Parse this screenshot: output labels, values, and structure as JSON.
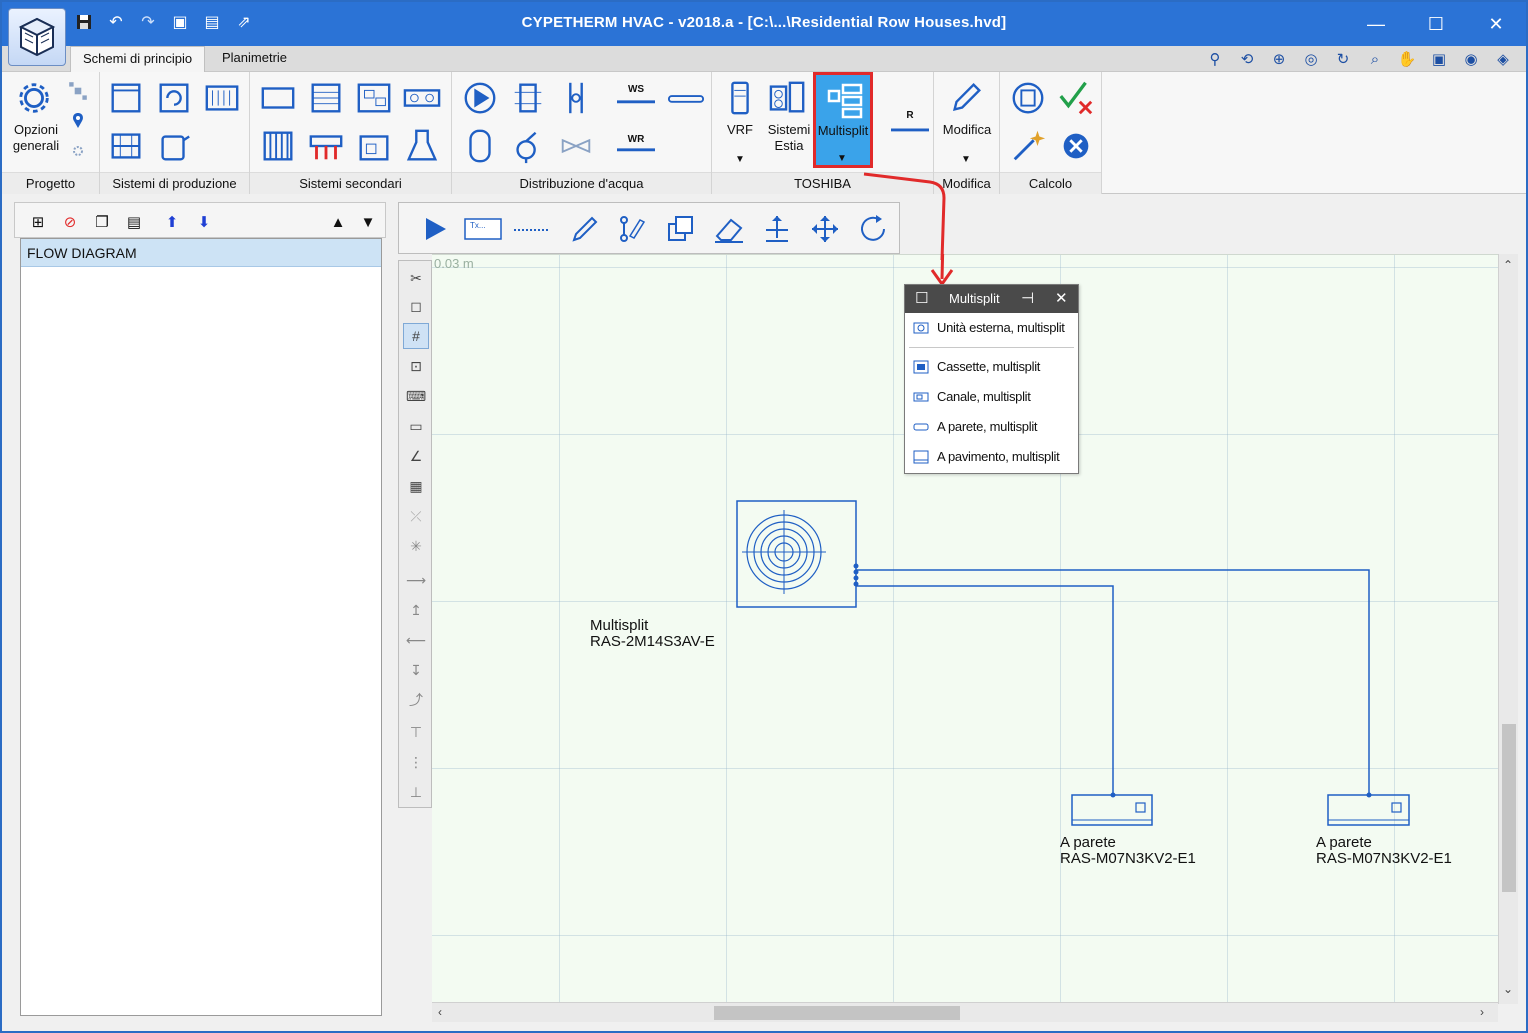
{
  "window": {
    "title": "CYPETHERM HVAC - v2018.a - [C:\\...\\Residential Row Houses.hvd]",
    "min_icon": "minimize-icon",
    "max_icon": "maximize-icon",
    "close_icon": "close-icon"
  },
  "tabs": [
    {
      "label": "Schemi di principio",
      "active": true
    },
    {
      "label": "Planimetrie",
      "active": false
    }
  ],
  "ribbon": {
    "groups": [
      {
        "label": "Progetto"
      },
      {
        "label": "Sistemi di produzione"
      },
      {
        "label": "Sistemi secondari"
      },
      {
        "label": "Distribuzione d'acqua"
      },
      {
        "label": "TOSHIBA"
      },
      {
        "label": "Modifica"
      },
      {
        "label": "Calcolo"
      }
    ],
    "opzioni_label": "Opzioni\ngenerali",
    "ws_label": "WS",
    "wr_label": "WR",
    "vrf_label": "VRF",
    "estia_label": "Sistemi\nEstia",
    "multisplit_label": "Multisplit",
    "r_label": "R",
    "modifica_label": "Modifica"
  },
  "tree": {
    "root": "FLOW DIAGRAM"
  },
  "canvas": {
    "scale_label": "0.03 m",
    "outdoor_unit": {
      "line1": "Multisplit",
      "line2": "RAS-2M14S3AV-E"
    },
    "indoor_units": [
      {
        "line1": "A parete",
        "line2": "RAS-M07N3KV2-E1"
      },
      {
        "line1": "A parete",
        "line2": "RAS-M07N3KV2-E1"
      }
    ],
    "accent": "#1f5fc4"
  },
  "popup": {
    "title": "Multisplit",
    "items": [
      {
        "label": "Unità esterna, multisplit"
      },
      {
        "label": "Cassette, multisplit"
      },
      {
        "label": "Canale, multisplit"
      },
      {
        "label": "A parete, multisplit"
      },
      {
        "label": "A pavimento, multisplit"
      }
    ]
  }
}
